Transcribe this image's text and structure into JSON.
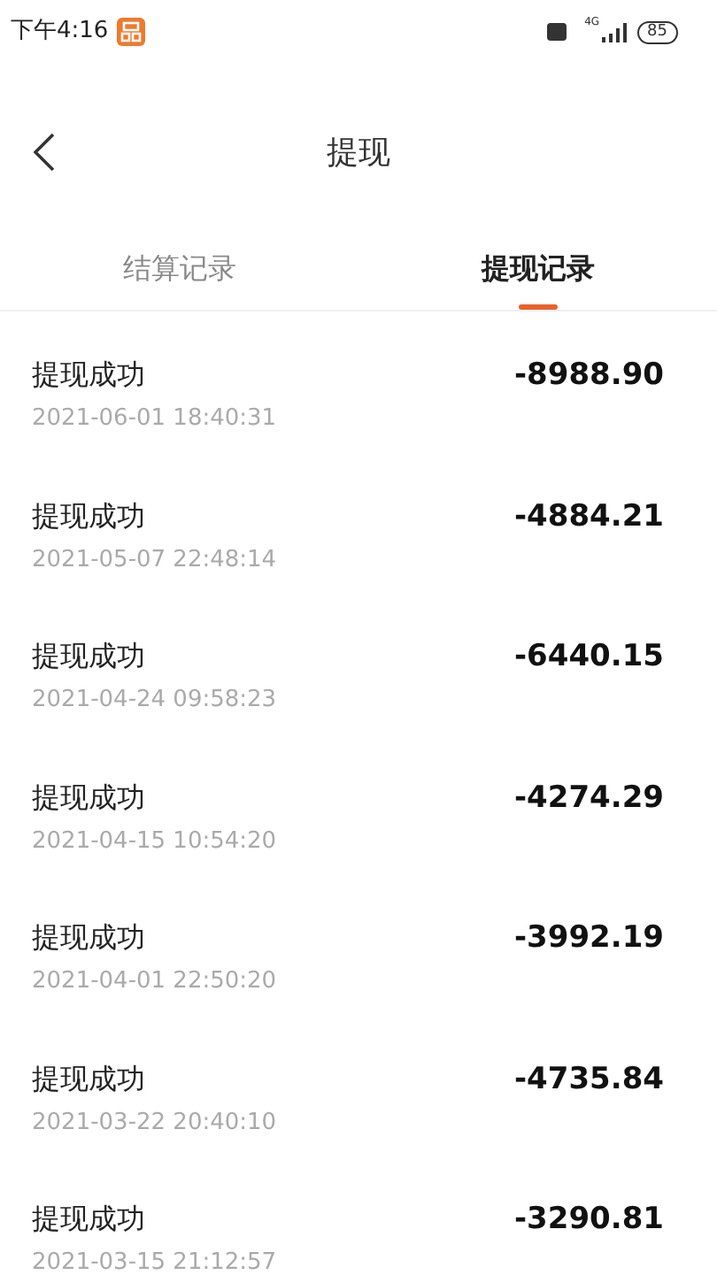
{
  "status_bar": {
    "time": "下午4:16",
    "network": "4G",
    "battery": "85"
  },
  "header": {
    "title": "提现"
  },
  "tabs": [
    {
      "label": "结算记录",
      "selected": false
    },
    {
      "label": "提现记录",
      "selected": true
    }
  ],
  "records": [
    {
      "status": "提现成功",
      "time": "2021-06-01 18:40:31",
      "amount": "-8988.90"
    },
    {
      "status": "提现成功",
      "time": "2021-05-07 22:48:14",
      "amount": "-4884.21"
    },
    {
      "status": "提现成功",
      "time": "2021-04-24 09:58:23",
      "amount": "-6440.15"
    },
    {
      "status": "提现成功",
      "time": "2021-04-15 10:54:20",
      "amount": "-4274.29"
    },
    {
      "status": "提现成功",
      "time": "2021-04-01 22:50:20",
      "amount": "-3992.19"
    },
    {
      "status": "提现成功",
      "time": "2021-03-22 20:40:10",
      "amount": "-4735.84"
    },
    {
      "status": "提现成功",
      "time": "2021-03-15 21:12:57",
      "amount": "-3290.81"
    }
  ]
}
